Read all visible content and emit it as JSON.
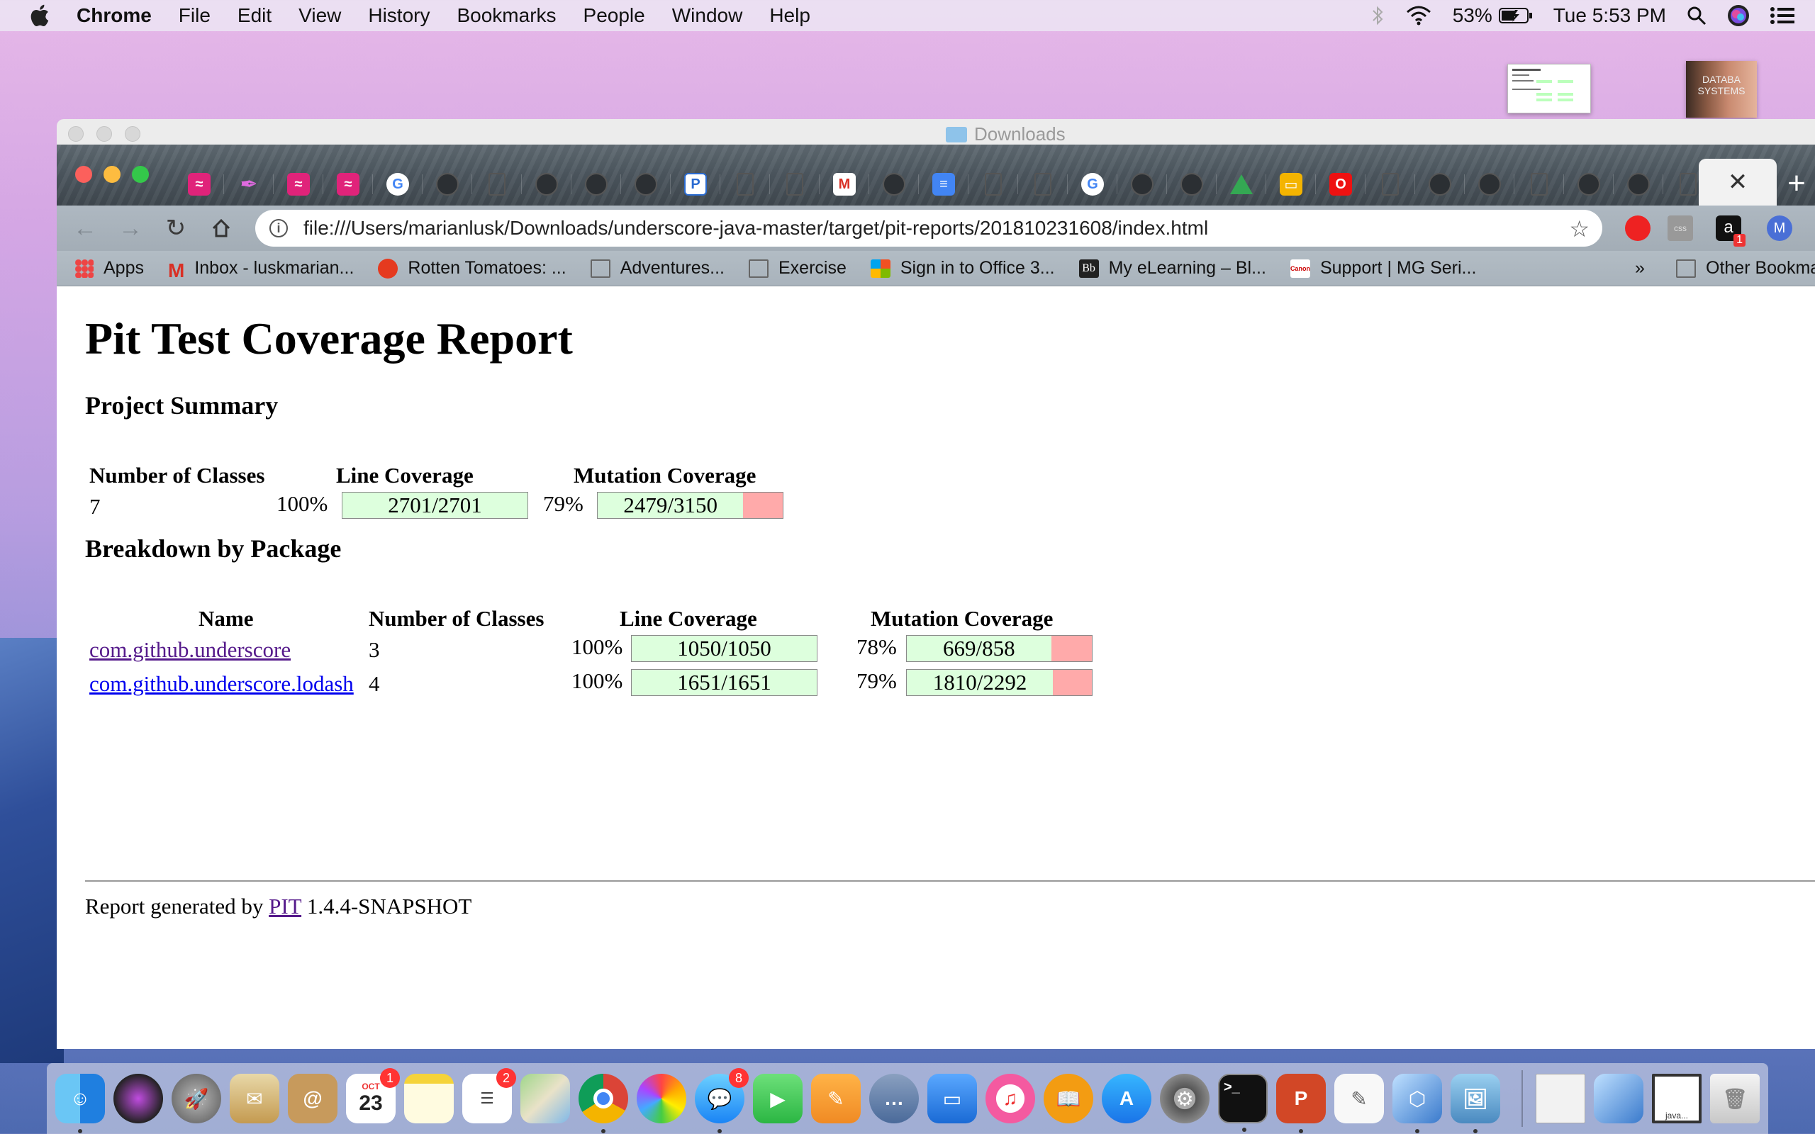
{
  "menubar": {
    "app": "Chrome",
    "items": [
      "File",
      "Edit",
      "View",
      "History",
      "Bookmarks",
      "People",
      "Window",
      "Help"
    ],
    "battery": "53%",
    "clock": "Tue 5:53 PM"
  },
  "desktop": {
    "thumb2_label": "DATABA SYSTEMS"
  },
  "finder_window": {
    "title": "Downloads"
  },
  "browser": {
    "address": "file:///Users/marianlusk/Downloads/underscore-java-master/target/pit-reports/201810231608/index.html",
    "extension_badge": "1",
    "profile_initial": "M",
    "tab_favicons": [
      "pink-waves",
      "feather",
      "pink-waves",
      "pink-waves",
      "google",
      "github",
      "document",
      "github",
      "github",
      "github",
      "p-box",
      "document",
      "document",
      "gmail",
      "github",
      "google-docs",
      "document",
      "document",
      "google",
      "github",
      "github",
      "google-drive",
      "google-slides",
      "oracle",
      "document",
      "github",
      "github",
      "document",
      "github",
      "github",
      "document"
    ],
    "bookmarks": [
      {
        "label": "Apps",
        "icon": "apps-grid-icon"
      },
      {
        "label": "Inbox - luskmarian...",
        "icon": "gmail-icon"
      },
      {
        "label": "Rotten Tomatoes: ...",
        "icon": "tomato-icon"
      },
      {
        "label": "Adventures...",
        "icon": "folder-icon"
      },
      {
        "label": "Exercise",
        "icon": "folder-icon"
      },
      {
        "label": "Sign in to Office 3...",
        "icon": "microsoft-icon"
      },
      {
        "label": "My eLearning – Bl...",
        "icon": "blackboard-icon"
      },
      {
        "label": "Support | MG Seri...",
        "icon": "canon-icon"
      }
    ],
    "bookmarks_overflow": "»",
    "other_bookmarks": "Other Bookmarks"
  },
  "report": {
    "title": "Pit Test Coverage Report",
    "summary_heading": "Project Summary",
    "summary_headers": [
      "Number of Classes",
      "Line Coverage",
      "Mutation Coverage"
    ],
    "summary": {
      "classes": "7",
      "line_pct": "100%",
      "line_ratio": "2701/2701",
      "line_fraction": 1.0,
      "mutation_pct": "79%",
      "mutation_ratio": "2479/3150",
      "mutation_fraction": 0.787
    },
    "breakdown_heading": "Breakdown by Package",
    "breakdown_headers": [
      "Name",
      "Number of Classes",
      "Line Coverage",
      "Mutation Coverage"
    ],
    "packages": [
      {
        "name": "com.github.underscore",
        "classes": "3",
        "line_pct": "100%",
        "line_ratio": "1050/1050",
        "line_fraction": 1.0,
        "mutation_pct": "78%",
        "mutation_ratio": "669/858",
        "mutation_fraction": 0.78
      },
      {
        "name": "com.github.underscore.lodash",
        "classes": "4",
        "line_pct": "100%",
        "line_ratio": "1651/1651",
        "line_fraction": 1.0,
        "mutation_pct": "79%",
        "mutation_ratio": "1810/2292",
        "mutation_fraction": 0.79
      }
    ],
    "footer_prefix": "Report generated by",
    "footer_link": "PIT",
    "footer_version": "1.4.4-SNAPSHOT"
  },
  "dock": {
    "calendar_month": "OCT",
    "calendar_day": "23",
    "calendar_badge": "1",
    "reminders_badge": "2",
    "messages_badge": "8",
    "java_label": "java..."
  },
  "colors": {
    "covered": "#ddffdd",
    "uncovered": "#ffaaaa",
    "link": "#0000ee",
    "visited_link": "#551a8b"
  }
}
